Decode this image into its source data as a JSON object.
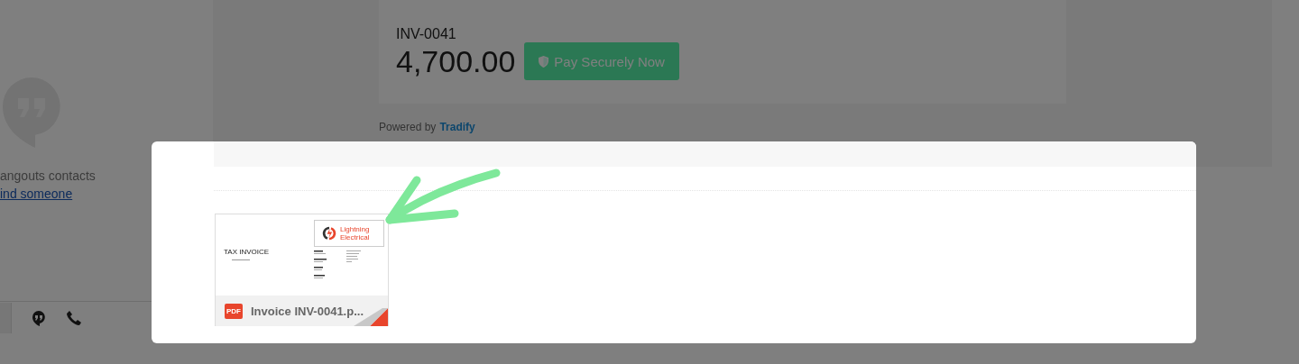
{
  "sidebar": {
    "contacts_text": "angouts contacts",
    "find_link": "ind someone"
  },
  "invoice": {
    "number": "INV-0041",
    "amount": "4,700.00",
    "pay_button": "Pay Securely Now"
  },
  "footer": {
    "powered_by": "Powered by",
    "brand": "Tradify"
  },
  "dialog": {
    "attachments": [
      {
        "name": "Invoice INV-0041.p...",
        "file_type": "PDF",
        "preview": {
          "title": "TAX INVOICE",
          "company": [
            "Lightning",
            "Electrical"
          ]
        }
      }
    ]
  }
}
